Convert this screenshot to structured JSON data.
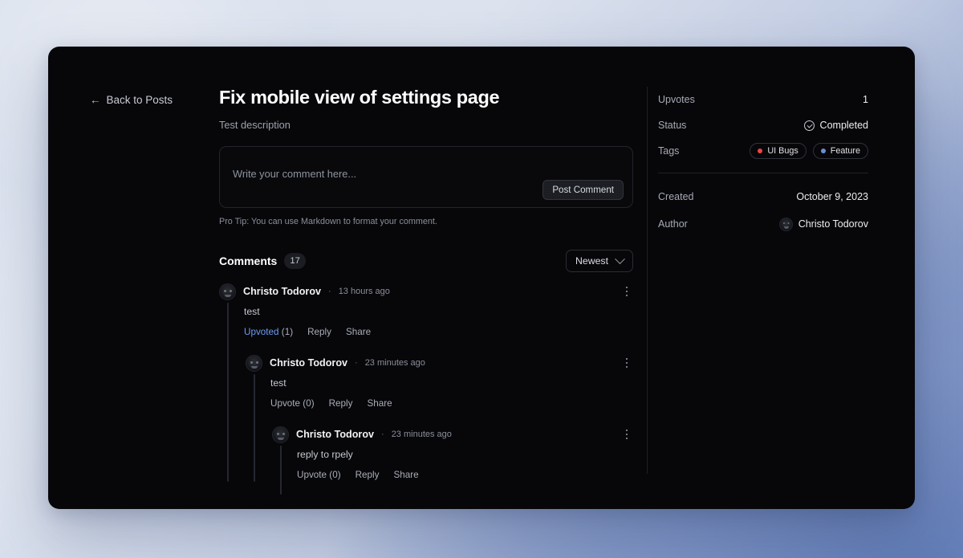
{
  "back_link": {
    "label": "Back to Posts",
    "arrow": "←",
    "icon": "arrow-left-icon"
  },
  "post": {
    "title": "Fix mobile view of settings page",
    "description": "Test description"
  },
  "composer": {
    "placeholder": "Write your comment here...",
    "submit_label": "Post Comment",
    "pro_tip": "Pro Tip: You can use Markdown to format your comment."
  },
  "comments_section": {
    "title": "Comments",
    "count": "17",
    "sort_label": "Newest",
    "sort_icon": "chevron-down-icon"
  },
  "comments": [
    {
      "author": "Christo Todorov",
      "separator": "·",
      "timestamp": "13 hours ago",
      "body": "test",
      "upvote_label": "Upvoted",
      "upvote_count": "(1)",
      "reply_label": "Reply",
      "share_label": "Share",
      "menu_icon": "more-vertical-icon"
    },
    {
      "author": "Christo Todorov",
      "separator": "·",
      "timestamp": "23 minutes ago",
      "body": "test",
      "upvote_label": "Upvote",
      "upvote_count": "(0)",
      "reply_label": "Reply",
      "share_label": "Share",
      "menu_icon": "more-vertical-icon"
    },
    {
      "author": "Christo Todorov",
      "separator": "·",
      "timestamp": "23 minutes ago",
      "body": "reply to rpely",
      "upvote_label": "Upvote",
      "upvote_count": "(0)",
      "reply_label": "Reply",
      "share_label": "Share",
      "menu_icon": "more-vertical-icon"
    }
  ],
  "meta": {
    "upvotes_label": "Upvotes",
    "upvotes_value": "1",
    "status_label": "Status",
    "status_value": "Completed",
    "status_icon": "check-circle-icon",
    "tags_label": "Tags",
    "tags": [
      {
        "name": "UI Bugs",
        "color": "#ef4444"
      },
      {
        "name": "Feature",
        "color": "#6b8fd4"
      }
    ],
    "created_label": "Created",
    "created_value": "October 9, 2023",
    "author_label": "Author",
    "author_value": "Christo Todorov",
    "author_avatar": "avatar"
  }
}
